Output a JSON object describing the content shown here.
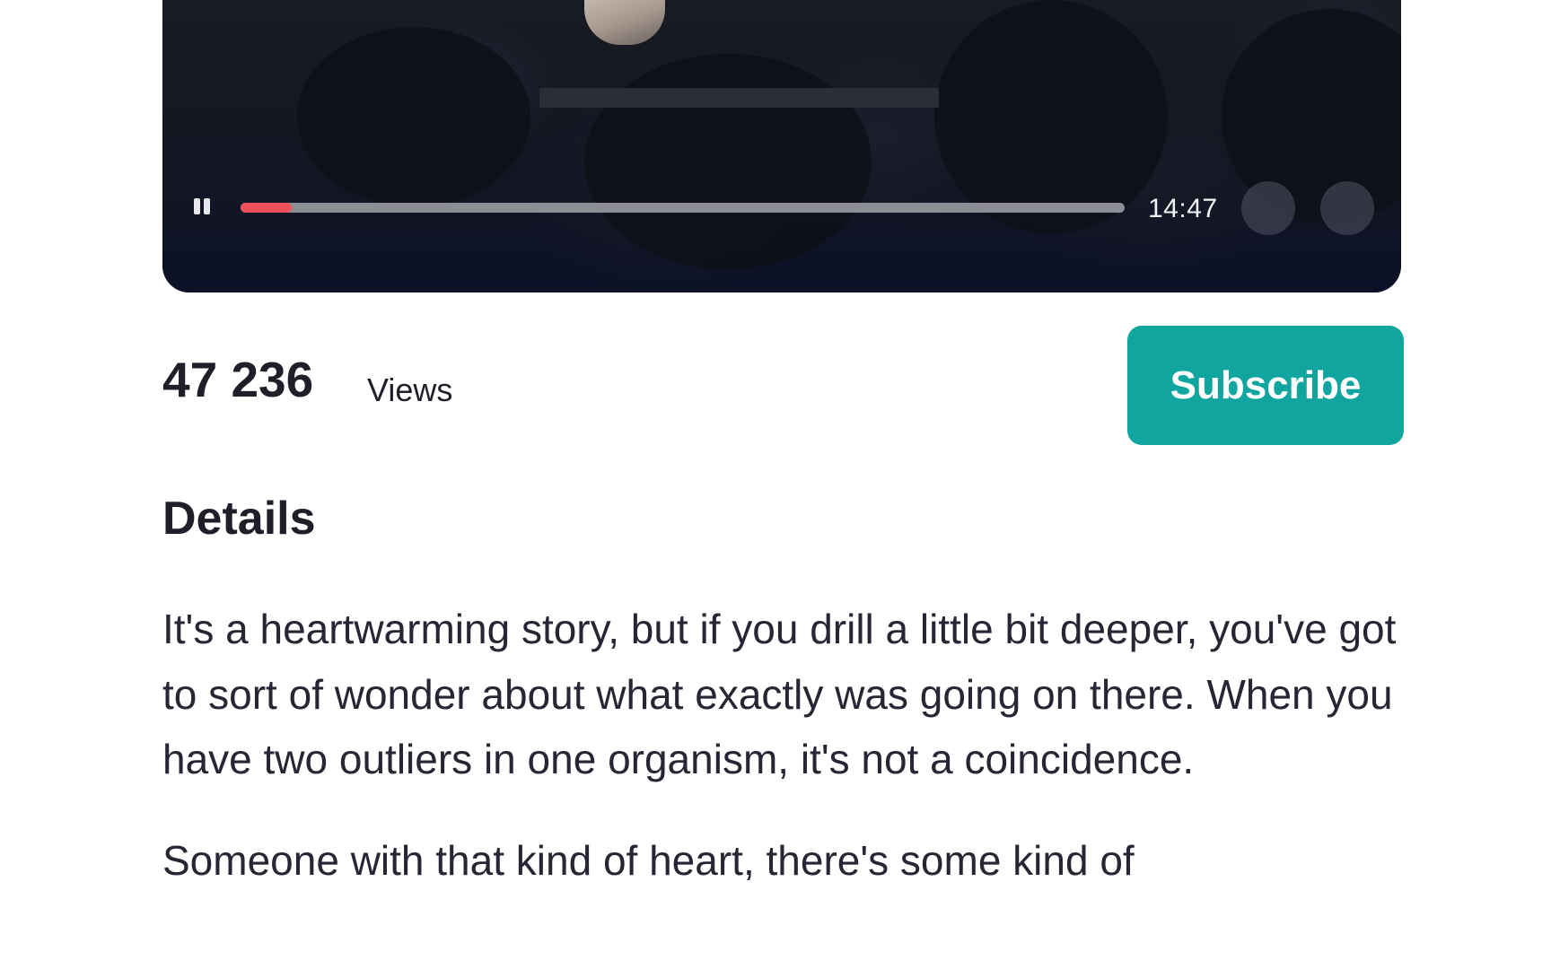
{
  "player": {
    "current_time": "14:47",
    "progress_fraction": 0.058,
    "pause_icon": "pause-icon",
    "accent_color": "#f0505a"
  },
  "stats": {
    "views_count": "47 236",
    "views_label": "Views"
  },
  "subscribe": {
    "label": "Subscribe",
    "color": "#11a59f"
  },
  "details": {
    "heading": "Details",
    "paragraphs": [
      "It's a heartwarming story, but if you drill a little bit deeper, you've got to sort of wonder about what exactly was going on there. When you have two outliers in one organism, it's not a coincidence.",
      "Someone with that kind of heart, there's some kind of"
    ]
  }
}
